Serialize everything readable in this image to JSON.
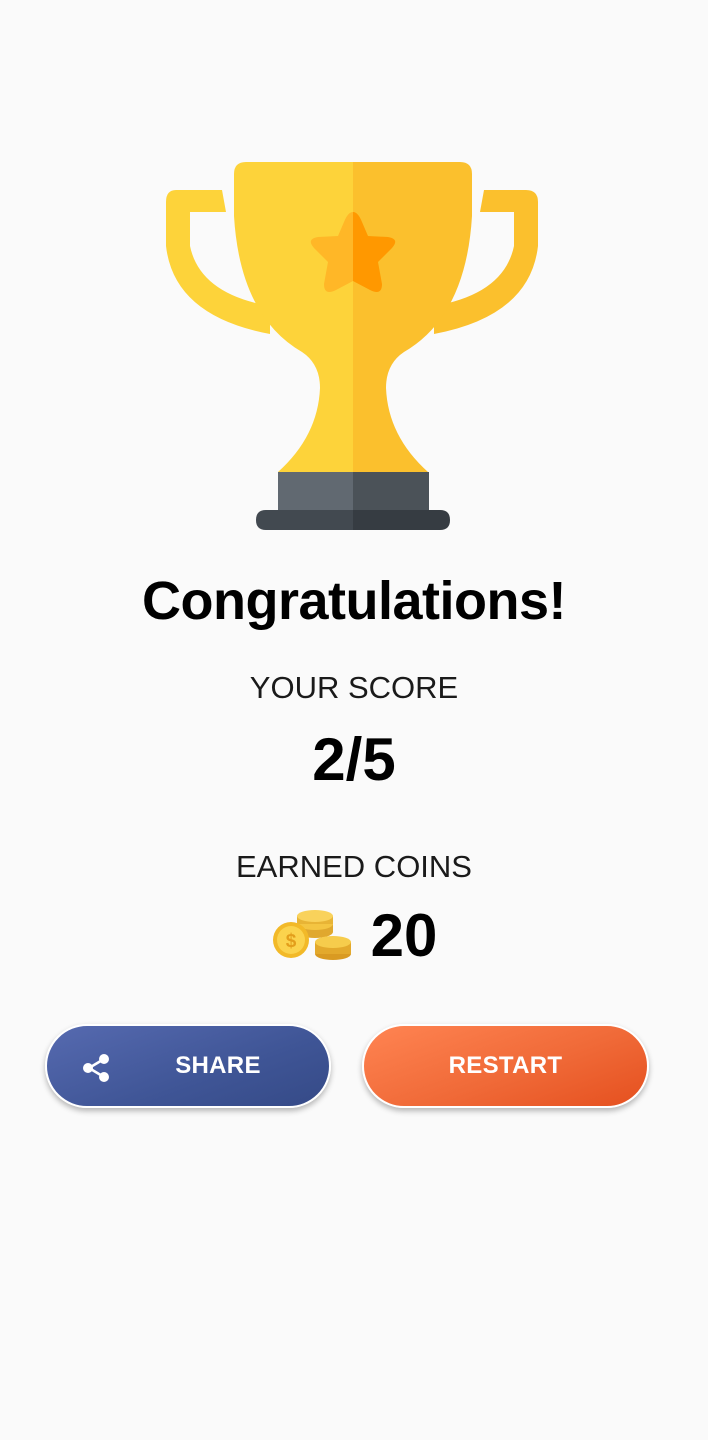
{
  "result": {
    "title": "Congratulations!",
    "score_label": "YOUR SCORE",
    "score_value": "2/5",
    "coins_label": "EARNED COINS",
    "coins_value": "20"
  },
  "actions": {
    "share_label": "SHARE",
    "restart_label": "RESTART"
  },
  "icons": {
    "trophy": "trophy-icon",
    "coins": "coins-icon",
    "share": "share-icon"
  },
  "colors": {
    "background": "#fafafa",
    "share_button": "#4459a0",
    "restart_button": "#f06a38",
    "trophy_gold": "#fbc02d",
    "trophy_base": "#4b5258"
  }
}
